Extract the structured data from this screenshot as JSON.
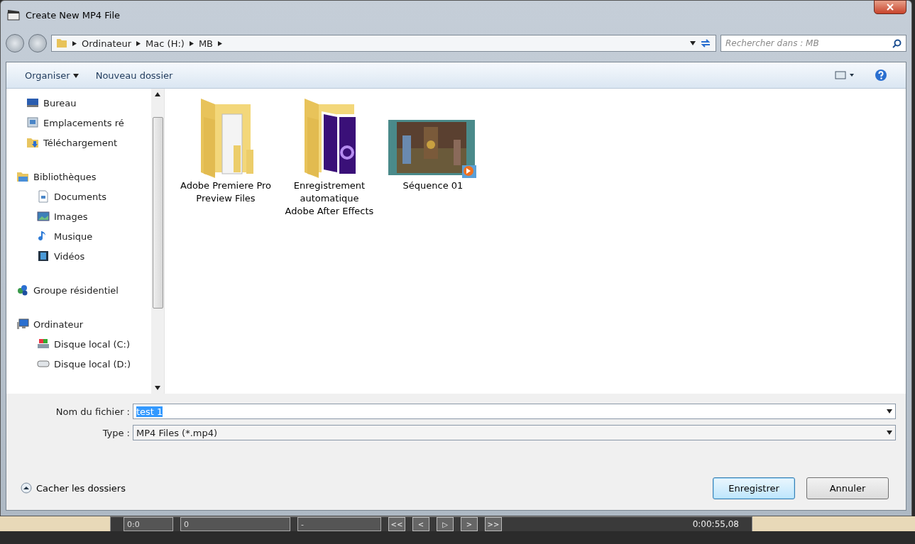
{
  "window": {
    "title": "Create New MP4 File"
  },
  "address_bar": {
    "path": [
      "Ordinateur",
      "Mac (H:)",
      "MB"
    ],
    "search_placeholder": "Rechercher dans : MB"
  },
  "toolbar": {
    "organize": "Organiser",
    "new_folder": "Nouveau dossier"
  },
  "sidebar": {
    "sections": [
      {
        "items": [
          {
            "label": "Bureau"
          },
          {
            "label": "Emplacements ré"
          },
          {
            "label": "Téléchargement"
          }
        ]
      },
      {
        "title": "Bibliothèques",
        "items": [
          {
            "label": "Documents"
          },
          {
            "label": "Images"
          },
          {
            "label": "Musique"
          },
          {
            "label": "Vidéos"
          }
        ]
      },
      {
        "title": "Groupe résidentiel"
      },
      {
        "title": "Ordinateur",
        "items": [
          {
            "label": "Disque local (C:)"
          },
          {
            "label": "Disque local (D:)"
          }
        ]
      }
    ]
  },
  "files": [
    {
      "kind": "folder",
      "name": "Adobe Premiere Pro Preview Files"
    },
    {
      "kind": "folder",
      "name": "Enregistrement automatique Adobe After Effects"
    },
    {
      "kind": "video",
      "name": "Séquence 01"
    }
  ],
  "form": {
    "filename_label": "Nom du fichier :",
    "filename": "test 1",
    "filename_selected": true,
    "type_label": "Type :",
    "type": "MP4 Files (*.mp4)"
  },
  "footer": {
    "toggle": "Cacher les dossiers",
    "buttons": [
      {
        "label": "Enregistrer",
        "default": true
      },
      {
        "label": "Annuler",
        "default": false
      }
    ]
  },
  "background_app": {
    "dropdowns": [
      "0:0",
      "0",
      "-"
    ],
    "buttons": [
      "<<",
      "<",
      "▷",
      ">",
      ">>"
    ],
    "time": "0:00:55,08"
  }
}
